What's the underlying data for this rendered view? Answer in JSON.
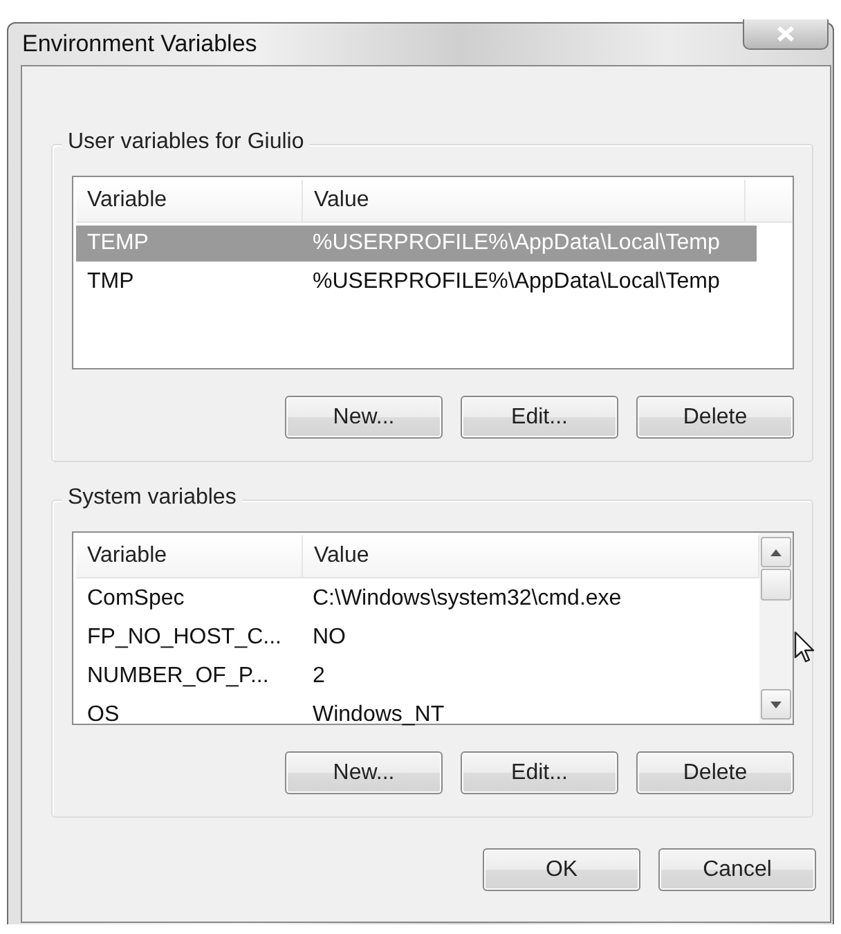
{
  "window": {
    "title": "Environment Variables"
  },
  "groups": [
    {
      "title": "User variables for Giulio",
      "columns": [
        "Variable",
        "Value"
      ],
      "scrollbar": false,
      "rows": [
        {
          "name": "TEMP",
          "value": "%USERPROFILE%\\AppData\\Local\\Temp",
          "selected": true
        },
        {
          "name": "TMP",
          "value": "%USERPROFILE%\\AppData\\Local\\Temp",
          "selected": false
        }
      ],
      "buttons": [
        "New...",
        "Edit...",
        "Delete"
      ]
    },
    {
      "title": "System variables",
      "columns": [
        "Variable",
        "Value"
      ],
      "scrollbar": true,
      "rows": [
        {
          "name": "ComSpec",
          "value": "C:\\Windows\\system32\\cmd.exe",
          "selected": false
        },
        {
          "name": "FP_NO_HOST_C...",
          "value": "NO",
          "selected": false
        },
        {
          "name": "NUMBER_OF_P...",
          "value": "2",
          "selected": false
        },
        {
          "name": "OS",
          "value": "Windows_NT",
          "selected": false
        }
      ],
      "buttons": [
        "New...",
        "Edit...",
        "Delete"
      ]
    }
  ],
  "buttons": [
    "OK",
    "Cancel"
  ]
}
